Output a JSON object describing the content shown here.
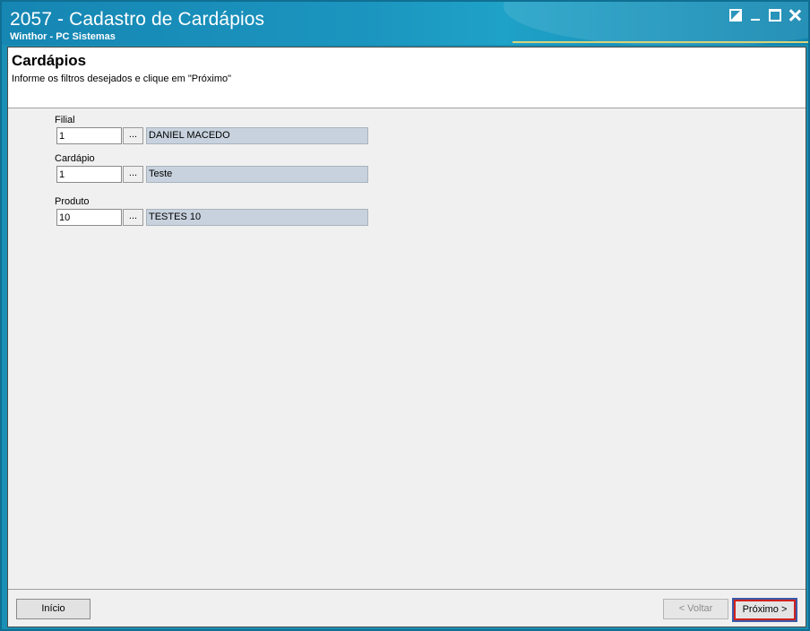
{
  "window": {
    "title": "2057 - Cadastro de Cardápios",
    "subtitle": "Winthor - PC Sistemas",
    "controls": [
      "restore-icon",
      "minimize-icon",
      "maximize-icon",
      "close-icon"
    ]
  },
  "header": {
    "heading": "Cardápios",
    "instructions": "Informe os filtros desejados e clique em \"Próximo\""
  },
  "filters": {
    "filial": {
      "label": "Filial",
      "code": "1",
      "lookup": "...",
      "description": "DANIEL MACEDO"
    },
    "cardapio": {
      "label": "Cardápio",
      "code": "1",
      "lookup": "...",
      "description": "Teste"
    },
    "produto": {
      "label": "Produto",
      "code": "10",
      "lookup": "...",
      "description": "TESTES 10"
    }
  },
  "footer": {
    "inicio": "Início",
    "voltar": "< Voltar",
    "proximo": "Próximo >"
  },
  "colors": {
    "titlebar": "#1b95bf",
    "description_bg": "#c7d2de",
    "focus_border": "#d0201e"
  }
}
